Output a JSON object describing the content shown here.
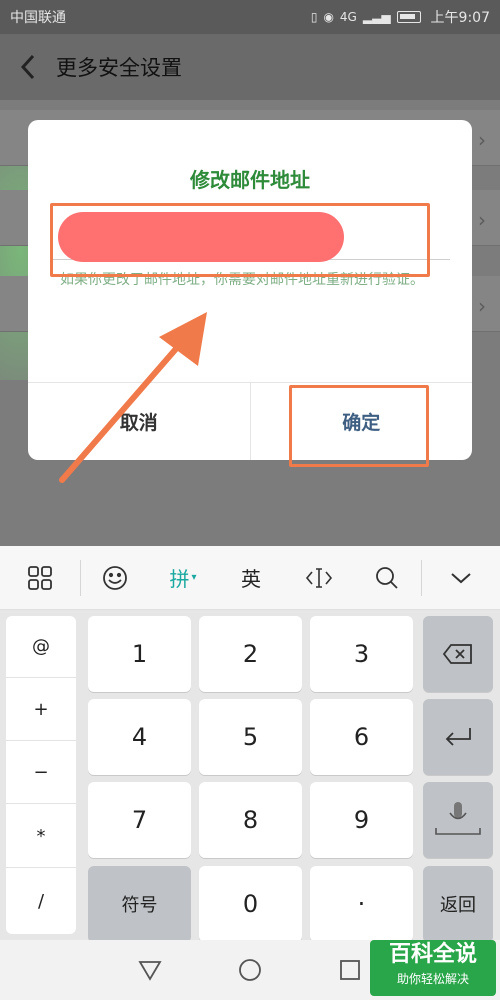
{
  "status_bar": {
    "carrier": "中国联通",
    "network": "4G",
    "time": "上午9:07"
  },
  "app_bar": {
    "title": "更多安全设置"
  },
  "dialog": {
    "title": "修改邮件地址",
    "email_value": "",
    "hint": "如果你更改了邮件地址，你需要对邮件地址重新进行验证。",
    "cancel": "取消",
    "confirm": "确定"
  },
  "keyboard_toolbar": {
    "pinyin": "拼",
    "english": "英"
  },
  "keyboard": {
    "symbols": [
      "@",
      "+",
      "−",
      "*",
      "/"
    ],
    "keys": [
      "1",
      "2",
      "3",
      "4",
      "5",
      "6",
      "7",
      "8",
      "9"
    ],
    "symbols_key": "符号",
    "zero": "0",
    "dot": "·",
    "return_key": "返回"
  },
  "watermark": {
    "main": "百科全说",
    "sub": "助你轻松解决"
  },
  "colors": {
    "title_green": "#2e8b3a",
    "highlight": "#f07a4a",
    "accent_teal": "#19a9a0"
  }
}
